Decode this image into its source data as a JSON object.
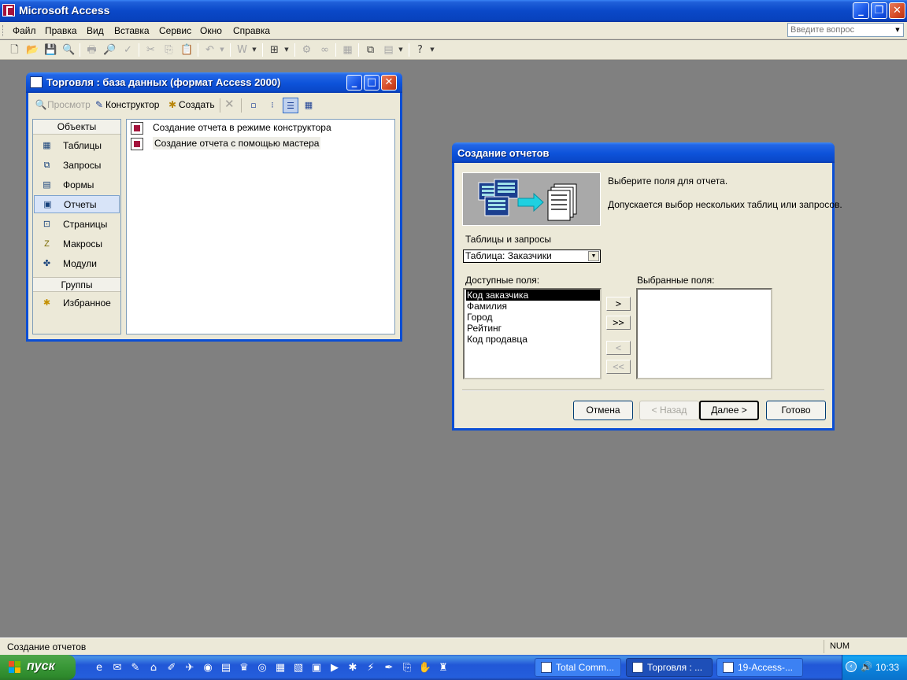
{
  "app": {
    "title": "Microsoft Access"
  },
  "window_controls": {
    "minimize": "_",
    "restore": "❐",
    "close": "✕"
  },
  "menu": {
    "items": [
      "Файл",
      "Правка",
      "Вид",
      "Вставка",
      "Сервис",
      "Окно",
      "Справка"
    ],
    "ask_placeholder": "Введите вопрос"
  },
  "db_window": {
    "title": "Торговля : база данных (формат Access 2000)",
    "toolbar": {
      "preview": "Просмотр",
      "design": "Конструктор",
      "create": "Создать"
    },
    "objects_header": "Объекты",
    "objects": [
      "Таблицы",
      "Запросы",
      "Формы",
      "Отчеты",
      "Страницы",
      "Макросы",
      "Модули"
    ],
    "selected_object": "Отчеты",
    "groups_header": "Группы",
    "groups": [
      "Избранное"
    ],
    "items": [
      "Создание отчета в режиме конструктора",
      "Создание отчета с помощью мастера"
    ]
  },
  "wizard": {
    "title": "Создание отчетов",
    "instruction1": "Выберите поля для отчета.",
    "instruction2": "Допускается выбор нескольких таблиц или запросов.",
    "tables_label": "Таблицы и запросы",
    "tables_value": "Таблица: Заказчики",
    "available_label": "Доступные поля:",
    "selected_label": "Выбранные поля:",
    "available_fields": [
      "Код заказчика",
      "Фамилия",
      "Город",
      "Рейтинг",
      "Код продавца"
    ],
    "selected_fields": [],
    "move_buttons": {
      "one": ">",
      "all": ">>",
      "back_one": "<",
      "back_all": "<<"
    },
    "buttons": {
      "cancel": "Отмена",
      "back": "< Назад",
      "next": "Далее >",
      "finish": "Готово"
    }
  },
  "status": {
    "text": "Создание отчетов",
    "num": "NUM"
  },
  "taskbar": {
    "start": "пуск",
    "tasks": [
      "Total Comm...",
      "Торговля : ...",
      "19-Access-..."
    ],
    "clock": "10:33"
  }
}
